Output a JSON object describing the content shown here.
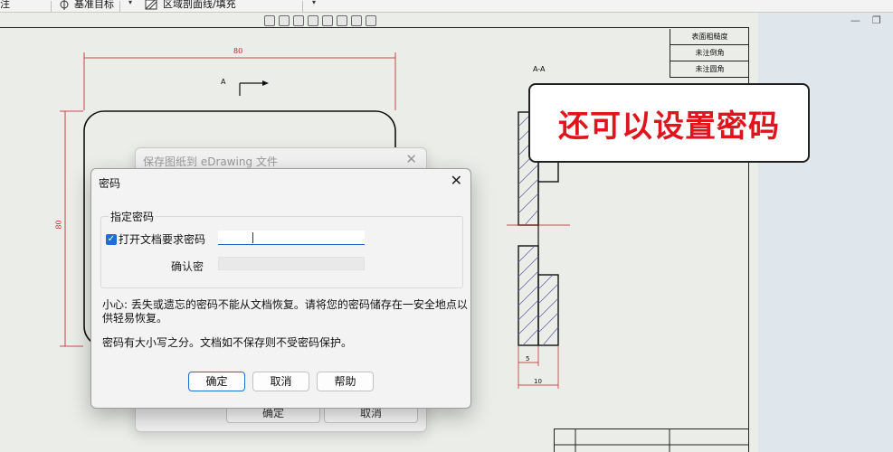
{
  "toolbar": {
    "item1": "注",
    "item2": "基准目标",
    "item3": "区域剖面线/填充"
  },
  "drawing": {
    "dim_top": "80",
    "dim_left": "80",
    "section_label_left": "A",
    "section_label_right": "A-A",
    "dim_bottom_small": "5",
    "dim_bottom_large": "10",
    "title_block_rows": [
      "表面粗糙度",
      "未注倒角",
      "未注圆角"
    ]
  },
  "callout": {
    "text": "还可以设置密码"
  },
  "bg_dialog": {
    "title": "保存图纸到 eDrawing 文件",
    "ok_label": "确定",
    "cancel_label": "取消"
  },
  "dialog": {
    "title": "密码",
    "group_label": "指定密码",
    "checkbox_label": "打开文档要求密码",
    "password_value": "",
    "confirm_label": "确认密",
    "confirm_value": "",
    "warning": "小心: 丢失或遗忘的密码不能从文档恢复。请将您的密码储存在一安全地点以供轻易恢复。",
    "note": "密码有大小写之分。文档如不保存则不受密码保护。",
    "ok_label": "确定",
    "cancel_label": "取消",
    "help_label": "帮助"
  },
  "colors": {
    "accent": "#1d6fd6",
    "callout_text": "#e0141c",
    "dimension": "#c0161c"
  }
}
